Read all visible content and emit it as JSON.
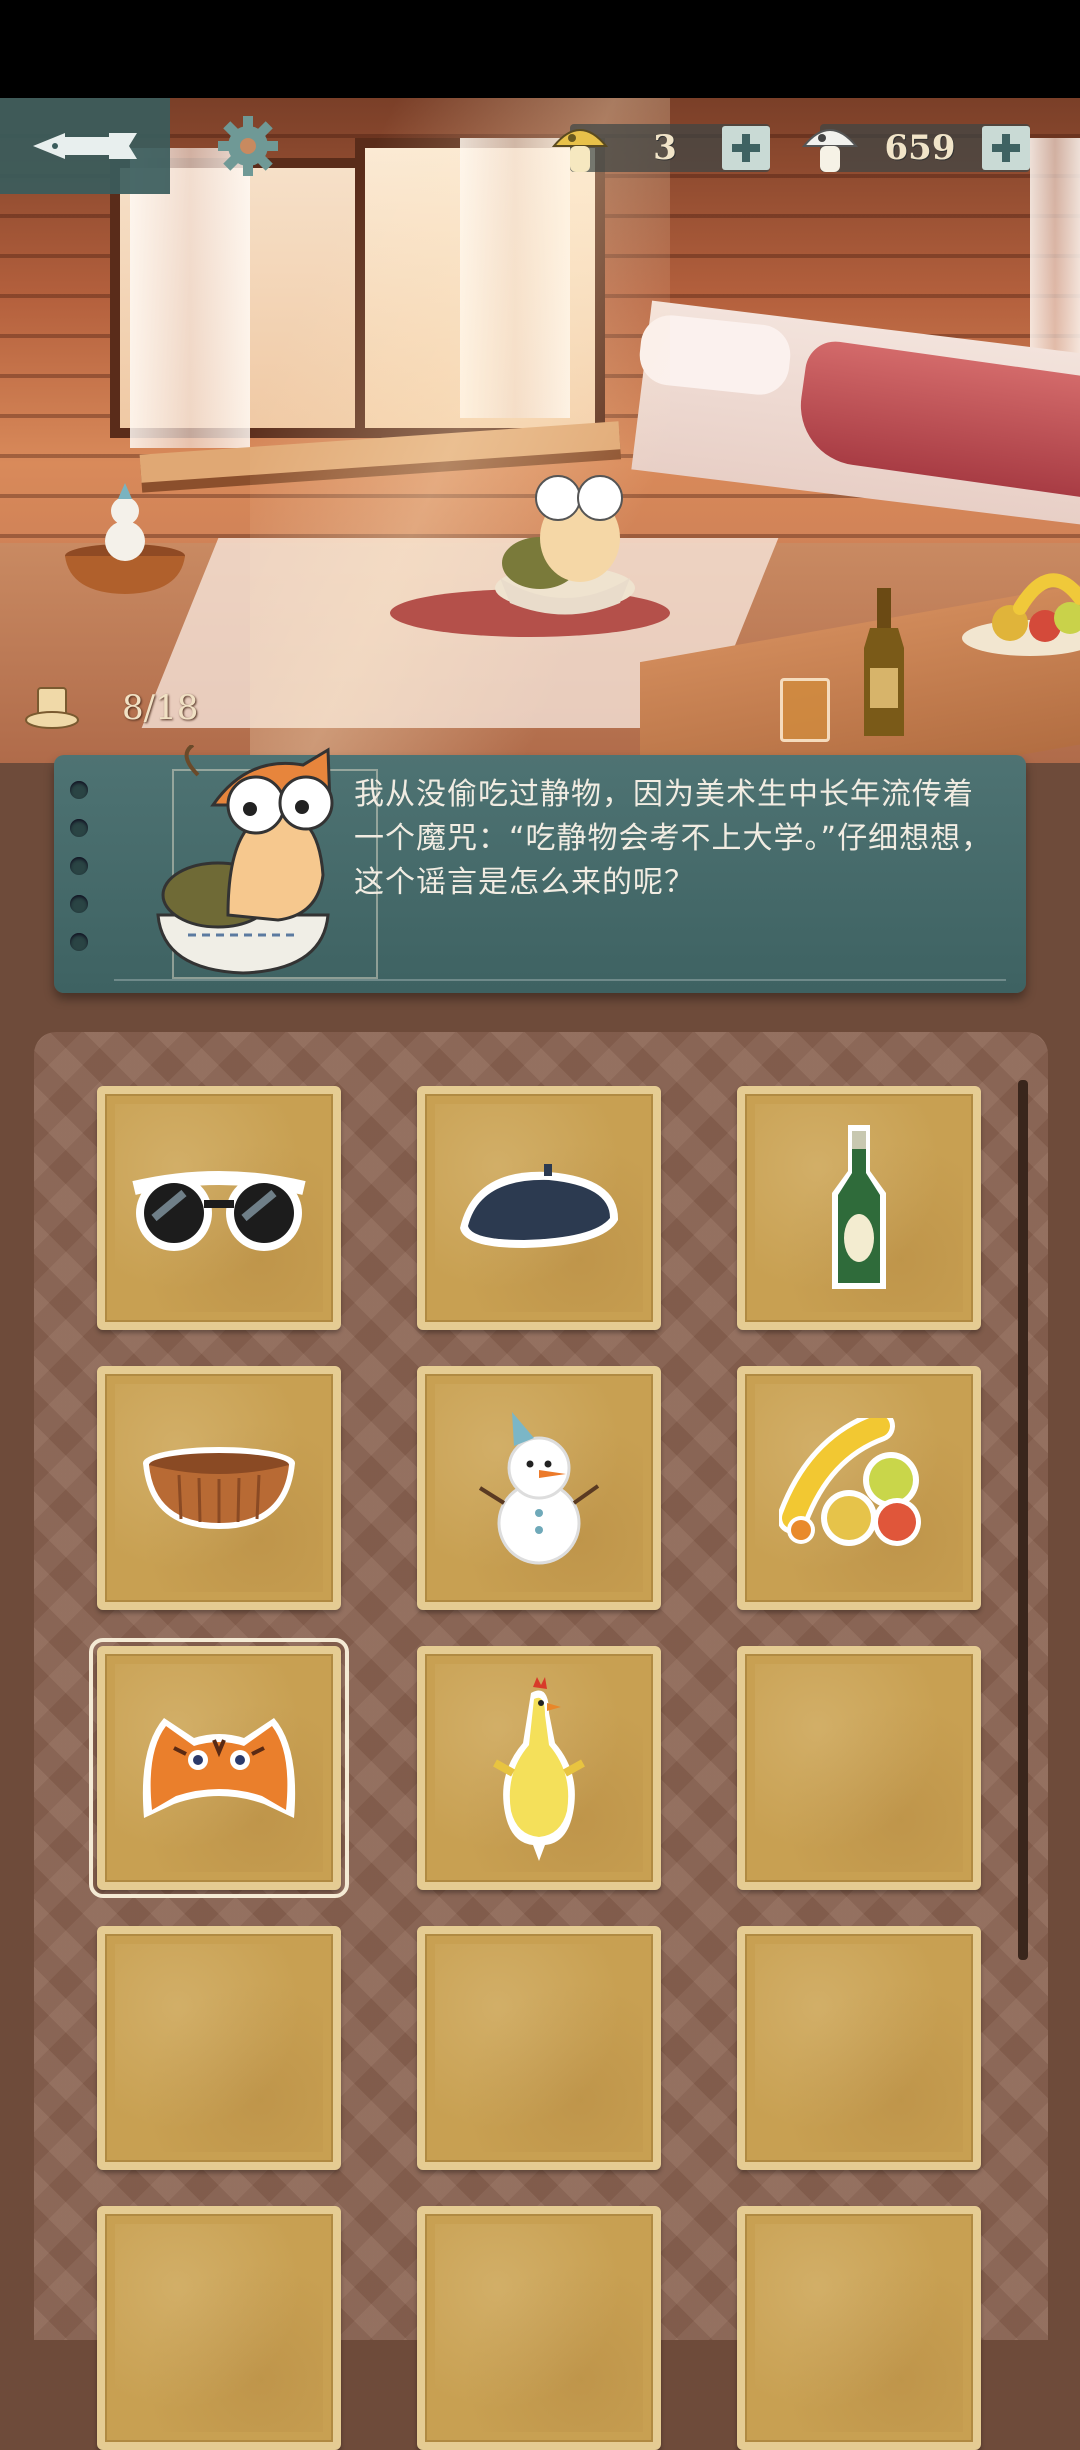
{
  "header": {
    "currency_1": {
      "icon": "yellow-mushroom-icon",
      "value": "3",
      "add": "+"
    },
    "currency_2": {
      "icon": "white-mushroom-icon",
      "value": "659",
      "add": "+"
    }
  },
  "progress": {
    "icon": "hat-icon",
    "text": "8/18"
  },
  "dialog": {
    "text": "我从没偷吃过静物，因为美术生中长年流传着一个魔咒：“吃静物会考不上大学。”仔细想想，这个谣言是怎么来的呢？"
  },
  "inventory": {
    "items": [
      {
        "name": "sunglasses-icon"
      },
      {
        "name": "beret-icon"
      },
      {
        "name": "green-bottle-icon"
      },
      {
        "name": "wooden-basket-icon"
      },
      {
        "name": "snowman-icon"
      },
      {
        "name": "fruit-icon"
      },
      {
        "name": "tiger-hat-icon",
        "selected": true
      },
      {
        "name": "rubber-chicken-icon"
      },
      {
        "name": "empty"
      },
      {
        "name": "empty"
      },
      {
        "name": "empty"
      },
      {
        "name": "empty"
      },
      {
        "name": "empty"
      },
      {
        "name": "empty"
      },
      {
        "name": "empty"
      }
    ]
  },
  "colors": {
    "teal": "#3e6262",
    "slot": "#c8a052",
    "slot_border": "#e5cc93",
    "panel": "#8a6351"
  }
}
